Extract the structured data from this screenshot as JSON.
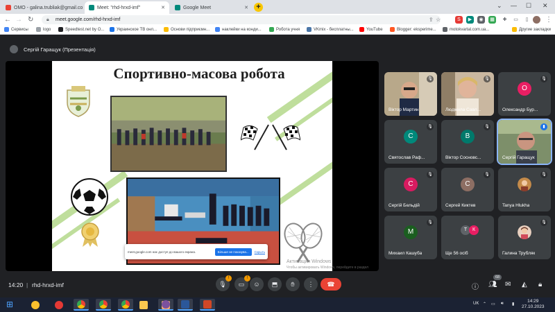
{
  "browser": {
    "tabs": [
      {
        "title": "OMO - galina.trubliak@gmail.co",
        "favicon_color": "#ea4335",
        "active": false
      },
      {
        "title": "Meet: \"rhd-hrxd-imf\"",
        "favicon_color": "#00897b",
        "active": true
      },
      {
        "title": "Google Meet",
        "favicon_color": "#00897b",
        "active": false
      }
    ],
    "new_tab_label": "+",
    "url": "meet.google.com/rhd-hrxd-imf",
    "bookmarks": [
      {
        "label": "Сервисы",
        "color": "#4285f4"
      },
      {
        "label": "logo",
        "color": "#9aa0a6"
      },
      {
        "label": "Speedtest.net by O...",
        "color": "#202124"
      },
      {
        "label": "Украинское ТВ онл...",
        "color": "#1a73e8"
      },
      {
        "label": "Основи підприємн...",
        "color": "#fbbc04"
      },
      {
        "label": "наклейки на конди...",
        "color": "#4285f4"
      },
      {
        "label": "Робота учня",
        "color": "#34a853"
      },
      {
        "label": "VKmix - бесплатны...",
        "color": "#4a76a8"
      },
      {
        "label": "YouTube",
        "color": "#ff0000"
      },
      {
        "label": "Blogger: eksperime...",
        "color": "#ff5722"
      },
      {
        "label": "motokvartal.com.ua...",
        "color": "#5f6368"
      },
      {
        "label": "Другие закладки",
        "color": "#fbbc04"
      }
    ]
  },
  "meet": {
    "presenter_label": "Сергій Гаращук (Презентація)",
    "slide": {
      "title": "Спортивно-масова  робота"
    },
    "share_notice": {
      "text": "meet.google.com нає доступ до вашого екрана.",
      "hide_button": "Більше не показува...",
      "stop_button": "Скрыть"
    },
    "watermark": {
      "line1": "Активация Windows",
      "line2": "Чтобы активировать Windows, перейдите в раздел \"Параметры\"."
    },
    "participants": [
      {
        "name": "Віктор Мартин",
        "type": "video",
        "muted": true
      },
      {
        "name": "Людмила Савл...",
        "type": "video",
        "muted": true
      },
      {
        "name": "Олександр Бур...",
        "type": "initial",
        "initial": "О",
        "color": "#e91e63",
        "muted": true
      },
      {
        "name": "Святослав Раф...",
        "type": "initial",
        "initial": "С",
        "color": "#00897b",
        "muted": true
      },
      {
        "name": "Віктор Сосновс...",
        "type": "initial",
        "initial": "В",
        "color": "#00796b",
        "muted": true
      },
      {
        "name": "Сергій Гаращук",
        "type": "video",
        "muted": false,
        "speaking": true
      },
      {
        "name": "Сергій Бельдій",
        "type": "initial",
        "initial": "С",
        "color": "#d81b60",
        "muted": true
      },
      {
        "name": "Сергей Киктев",
        "type": "initial",
        "initial": "С",
        "color": "#8d6e63",
        "muted": true
      },
      {
        "name": "Tanya Hlukha",
        "type": "avatar",
        "muted": true
      },
      {
        "name": "Михаил Кашуба",
        "type": "initial",
        "initial": "М",
        "color": "#1b5e20",
        "muted": true
      },
      {
        "name": "Ще 56 осіб",
        "type": "more",
        "initials": [
          "Т",
          "К"
        ]
      },
      {
        "name": "Галина Трубляк",
        "type": "avatar",
        "muted": true
      }
    ],
    "controls": {
      "time": "14:20",
      "separator": "|",
      "meeting_code": "rhd-hrxd-imf",
      "participants_badge": "68",
      "end_call_icon": "phone-hangup-icon"
    }
  },
  "taskbar": {
    "lang": "UK",
    "time": "14:29",
    "date": "27.10.2023"
  }
}
